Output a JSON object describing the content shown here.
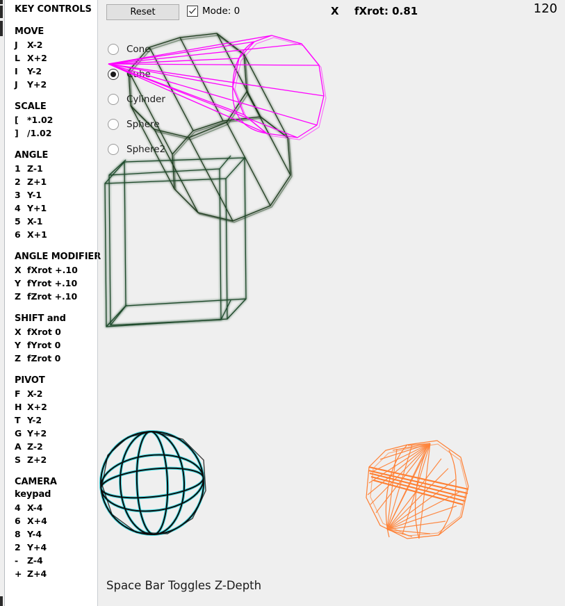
{
  "window": {
    "background_color": "#efefef",
    "sidebar_background_color": "#ffffff"
  },
  "sidebar": {
    "title": "KEY CONTROLS",
    "groups": [
      {
        "heading": "MOVE",
        "rows": [
          {
            "key": "J",
            "action": "X-2"
          },
          {
            "key": "L",
            "action": "X+2"
          },
          {
            "key": "I",
            "action": "Y-2"
          },
          {
            "key": "J",
            "action": "Y+2"
          }
        ]
      },
      {
        "heading": "SCALE",
        "rows": [
          {
            "key": "[",
            "action": "*1.02"
          },
          {
            "key": "]",
            "action": "/1.02"
          }
        ]
      },
      {
        "heading": "ANGLE",
        "rows": [
          {
            "key": "1",
            "action": "Z-1"
          },
          {
            "key": "2",
            "action": "Z+1"
          },
          {
            "key": "3",
            "action": "Y-1"
          },
          {
            "key": "4",
            "action": "Y+1"
          },
          {
            "key": "5",
            "action": "X-1"
          },
          {
            "key": "6",
            "action": "X+1"
          }
        ]
      },
      {
        "heading": "ANGLE MODIFIER",
        "rows": [
          {
            "key": "X",
            "action": "fXrot +.10"
          },
          {
            "key": "Y",
            "action": "fYrot +.10"
          },
          {
            "key": "Z",
            "action": "fZrot +.10"
          }
        ]
      },
      {
        "heading": "SHIFT and",
        "rows": [
          {
            "key": "X",
            "action": "fXrot 0"
          },
          {
            "key": "Y",
            "action": "fYrot 0"
          },
          {
            "key": "Z",
            "action": "fZrot 0"
          }
        ]
      },
      {
        "heading": "PIVOT",
        "rows": [
          {
            "key": "F",
            "action": "X-2"
          },
          {
            "key": "H",
            "action": "X+2"
          },
          {
            "key": "T",
            "action": "Y-2"
          },
          {
            "key": "G",
            "action": "Y+2"
          },
          {
            "key": "A",
            "action": "Z-2"
          },
          {
            "key": "S",
            "action": "Z+2"
          }
        ]
      },
      {
        "heading": "CAMERA",
        "subheading": "keypad",
        "rows": [
          {
            "key": "4",
            "action": "X-4"
          },
          {
            "key": "6",
            "action": "X+4"
          },
          {
            "key": "8",
            "action": "Y-4"
          },
          {
            "key": "2",
            "action": "Y+4"
          },
          {
            "key": "-",
            "action": "Z-4"
          },
          {
            "key": "+",
            "action": "Z+4"
          }
        ]
      }
    ]
  },
  "toolbar": {
    "reset_label": "Reset",
    "mode_label": "Mode: 0",
    "mode_checked": true,
    "axis_label": "X",
    "rotation_label": "fXrot: 0.81",
    "counter": "120"
  },
  "shape_selector": {
    "selected": "Cube",
    "options": [
      {
        "label": "Cone",
        "selected": false
      },
      {
        "label": "Cube",
        "selected": true
      },
      {
        "label": "Cylinder",
        "selected": false
      },
      {
        "label": "Sphere",
        "selected": false
      },
      {
        "label": "Sphere2",
        "selected": false
      }
    ]
  },
  "viewport": {
    "shapes": [
      {
        "name": "prism-wireframe",
        "color": "#1f3d1f",
        "glow": "#2f7a2f"
      },
      {
        "name": "cone-wireframe",
        "color": "#ff00ff",
        "glow": "#ff00ff"
      },
      {
        "name": "cube-wireframe",
        "color": "#1f4a2a",
        "glow": "#2f7a2f"
      },
      {
        "name": "sphere-wireframe",
        "color": "#0a0a0a",
        "glow": "#26d7e0"
      },
      {
        "name": "sphere2-wireframe",
        "color": "#ff7f32",
        "glow": "#ff7f32"
      }
    ]
  },
  "footer": {
    "hint": "Space Bar Toggles Z-Depth"
  }
}
